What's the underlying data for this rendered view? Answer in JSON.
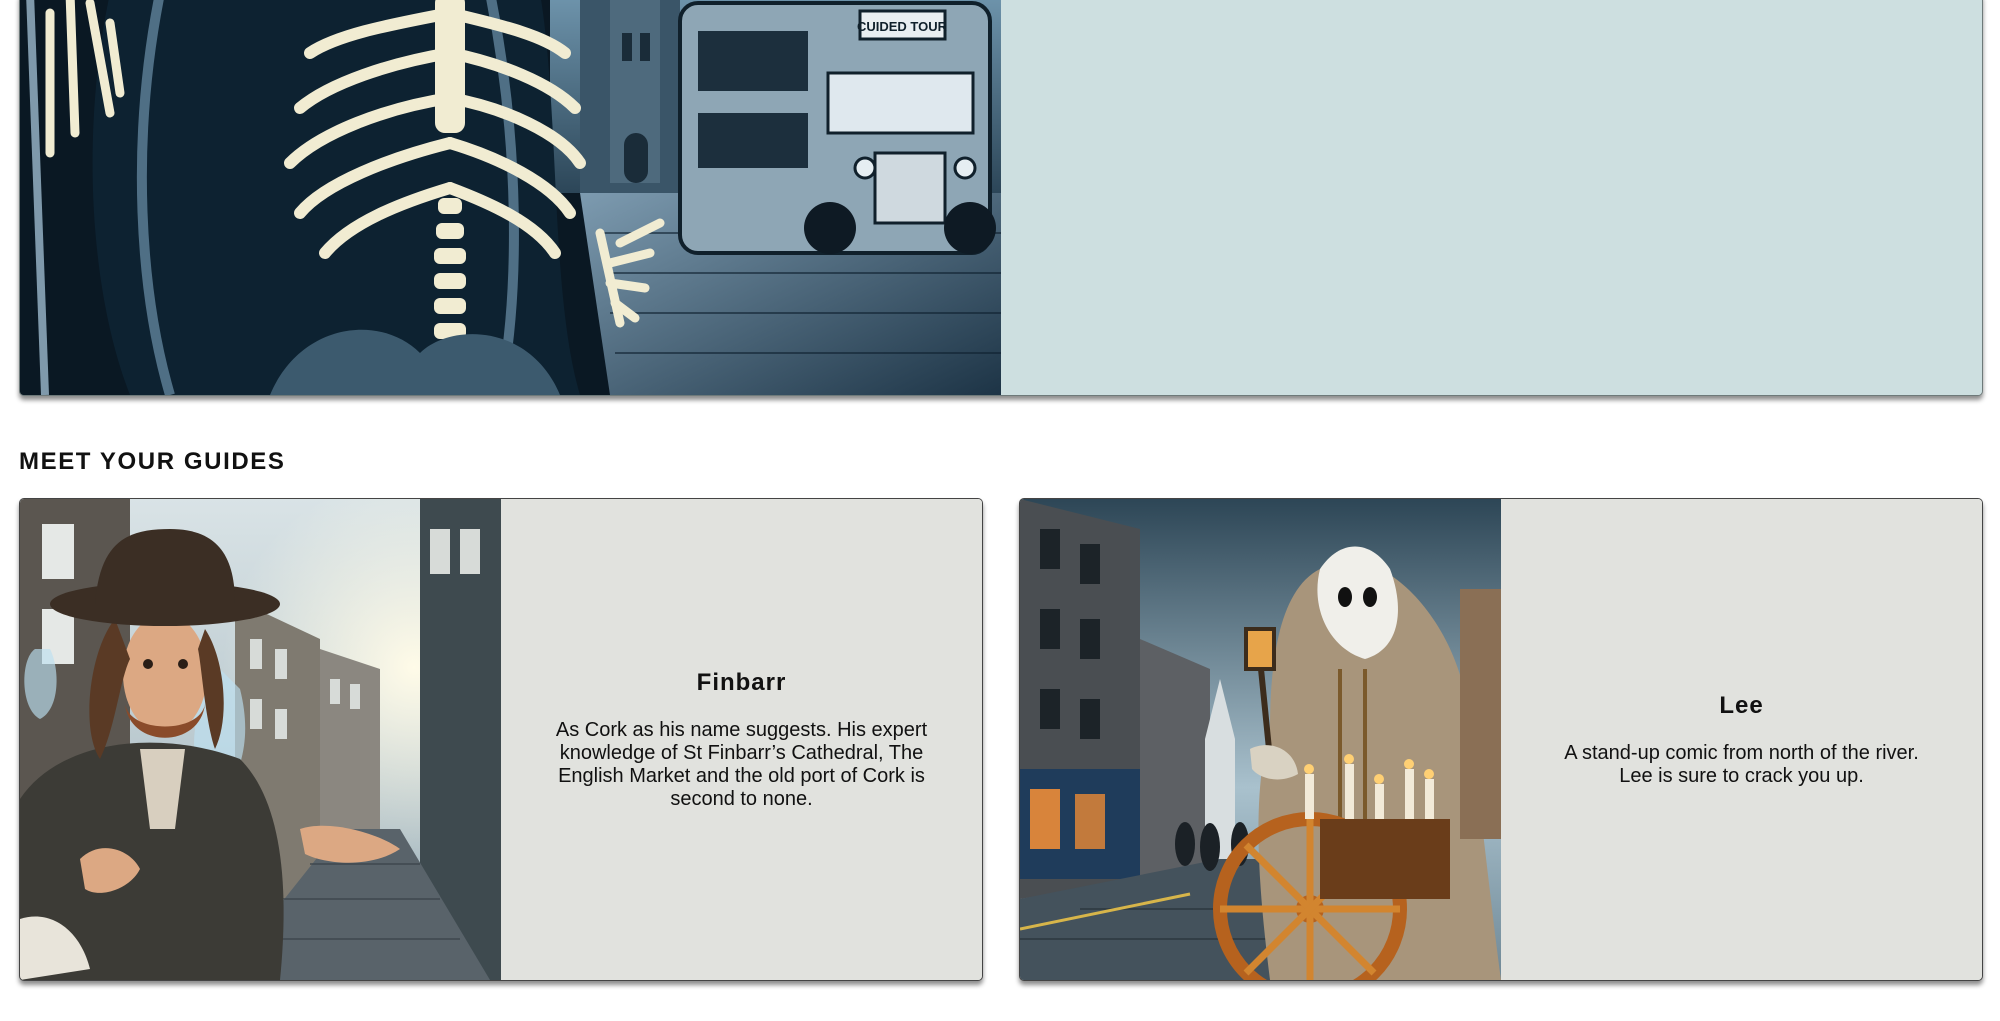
{
  "hero": {
    "image_alt": "Skeleton on a cobbled street beside a double-decker bus",
    "bus_sign": "CUIDED TOUR"
  },
  "section": {
    "title": "MEET YOUR GUIDES"
  },
  "guides": [
    {
      "name": "Finbarr",
      "description": "As Cork as his name suggests. His expert knowledge of St Finbarr’s Cathedral, The English Market and the old port of Cork is second to none.",
      "image_alt": "Startled man in a hat on a cobbled street with ghosts"
    },
    {
      "name": "Lee",
      "description": "A stand-up comic from north of the river. Lee is sure to crack you up.",
      "image_alt": "Ghost holding a lantern beside a cart of candles"
    }
  ],
  "colors": {
    "hero_panel": "#cddfe0",
    "card_panel": "#e1e2de",
    "text": "#111111"
  }
}
